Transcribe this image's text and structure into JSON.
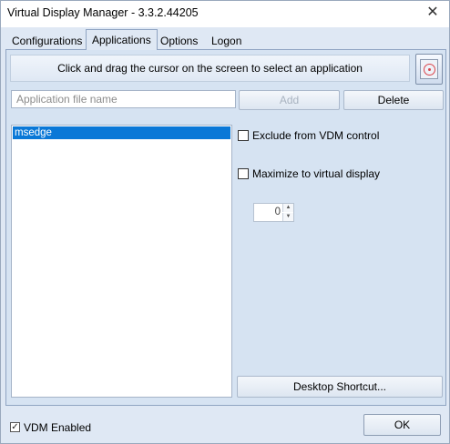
{
  "window": {
    "title": "Virtual Display Manager - 3.3.2.44205",
    "close_label": "✕"
  },
  "tabs": [
    {
      "label": "Configurations"
    },
    {
      "label": "Applications",
      "active": true
    },
    {
      "label": "Options"
    },
    {
      "label": "Logon"
    }
  ],
  "applications": {
    "hint": "Click and drag the cursor on the screen to select an application",
    "file_placeholder": "Application file name",
    "file_value": "",
    "add_label": "Add",
    "delete_label": "Delete",
    "list": [
      "msedge"
    ],
    "exclude_label": "Exclude from VDM control",
    "exclude_checked": false,
    "maximize_label": "Maximize to virtual display",
    "maximize_checked": false,
    "display_number": "0",
    "shortcut_label": "Desktop Shortcut..."
  },
  "footer": {
    "vdm_enabled_label": "VDM Enabled",
    "vdm_enabled_checked": true,
    "ok_label": "OK"
  },
  "icons": {
    "target": "crosshair-target-icon",
    "spin_up": "▲",
    "spin_down": "▼",
    "check_mark": "✓"
  },
  "colors": {
    "selection": "#0a78d7",
    "accent_red": "#d9434a"
  }
}
